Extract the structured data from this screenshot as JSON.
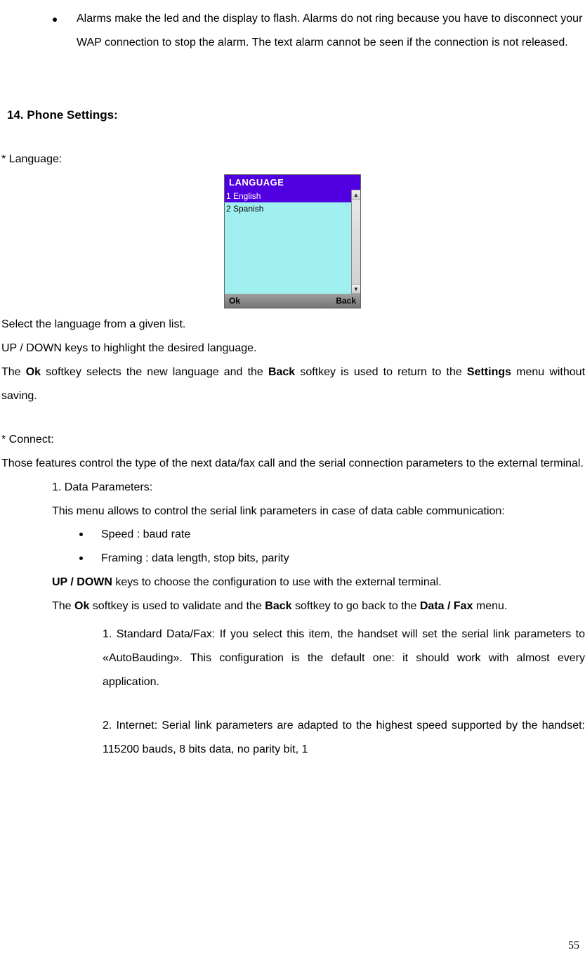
{
  "intro_bullet": "Alarms make the led and the display to flash. Alarms do not ring because you have to disconnect your WAP connection to stop the alarm. The text alarm cannot be seen if the connection is not released.",
  "heading": "14. Phone Settings:",
  "language": {
    "title": "* Language:",
    "screen_title": "LANGUAGE",
    "items": [
      "1 English",
      "2 Spanish"
    ],
    "ok": "Ok",
    "back": "Back",
    "para1": "Select the language from a given list.",
    "para2": "UP / DOWN keys to highlight the desired language.",
    "para3_a": "The ",
    "para3_ok": "Ok",
    "para3_b": " softkey selects the new language and the ",
    "para3_back": "Back",
    "para3_c": " softkey is used to return to the ",
    "para3_settings": "Settings",
    "para3_d": " menu without saving."
  },
  "connect": {
    "title": "* Connect:",
    "intro": "Those features control the type of the next data/fax call and the serial connection parameters to the external terminal.",
    "dp_title": "1. Data Parameters:",
    "dp_intro": "This menu allows to control the serial link parameters in case of data cable communication:",
    "bullet_speed": "Speed : baud rate",
    "bullet_framing": "Framing : data length, stop bits, parity",
    "updown_a": "UP / DOWN",
    "updown_b": " keys to choose the configuration to use with the external terminal.",
    "ok_back_a": "The ",
    "ok_back_ok": "Ok",
    "ok_back_b": " softkey is used to validate and the ",
    "ok_back_back": "Back",
    "ok_back_c": " softkey to go back to the ",
    "ok_back_datafax": "Data / Fax",
    "ok_back_d": " menu.",
    "std": "1. Standard Data/Fax: If you select this item, the handset will set the serial link parameters to «AutoBauding». This configuration is the default one: it should work with almost every application.",
    "internet": "2. Internet: Serial link parameters are adapted to the highest speed supported by the handset: 115200 bauds, 8 bits data, no parity bit, 1"
  },
  "page_number": "55"
}
